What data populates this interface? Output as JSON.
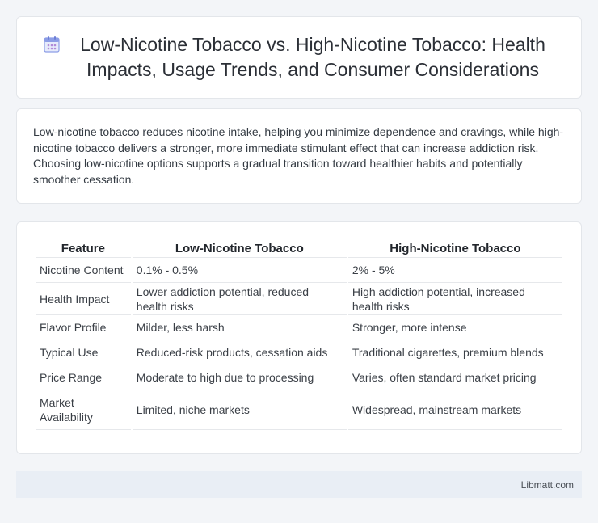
{
  "header": {
    "icon": "calendar-icon",
    "title": "Low-Nicotine Tobacco vs. High-Nicotine Tobacco: Health Impacts, Usage Trends, and Consumer Considerations"
  },
  "summary": {
    "text": "Low-nicotine tobacco reduces nicotine intake, helping you minimize dependence and cravings, while high-nicotine tobacco delivers a stronger, more immediate stimulant effect that can increase addiction risk. Choosing low-nicotine options supports a gradual transition toward healthier habits and potentially smoother cessation."
  },
  "table": {
    "headers": [
      "Feature",
      "Low-Nicotine Tobacco",
      "High-Nicotine Tobacco"
    ],
    "rows": [
      [
        "Nicotine Content",
        "0.1% - 0.5%",
        "2% - 5%"
      ],
      [
        "Health Impact",
        "Lower addiction potential, reduced health risks",
        "High addiction potential, increased health risks"
      ],
      [
        "Flavor Profile",
        "Milder, less harsh",
        "Stronger, more intense"
      ],
      [
        "Typical Use",
        "Reduced-risk products, cessation aids",
        "Traditional cigarettes, premium blends"
      ],
      [
        "Price Range",
        "Moderate to high due to processing",
        "Varies, often standard market pricing"
      ],
      [
        "Market Availability",
        "Limited, niche markets",
        "Widespread, mainstream markets"
      ]
    ]
  },
  "footer": {
    "text": "Libmatt.com"
  },
  "colors": {
    "page_background": "#f3f5f8",
    "card_background": "#ffffff",
    "footer_background": "#e9eef5",
    "icon_accent": "#7b8fe0"
  }
}
